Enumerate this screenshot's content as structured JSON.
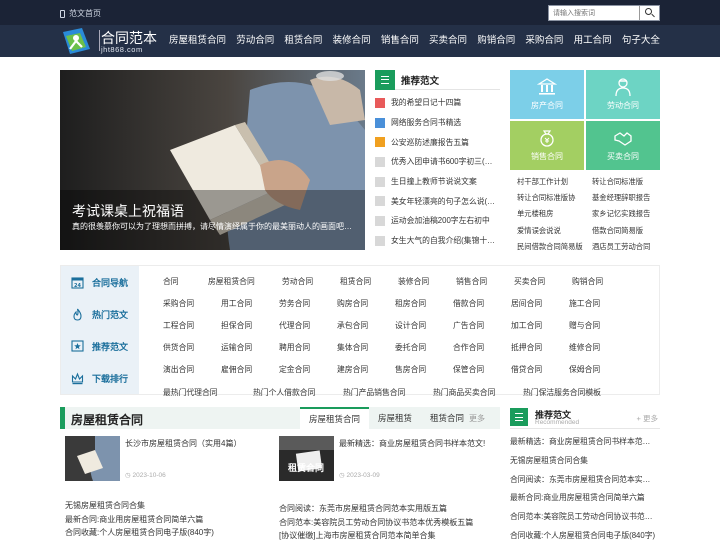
{
  "topbar": {
    "home_label": "范文首页",
    "search_placeholder": "请输入搜索词"
  },
  "logo": {
    "name": "合同范本",
    "domain": "jht868.com"
  },
  "nav": [
    "房屋租赁合同",
    "劳动合同",
    "租赁合同",
    "装修合同",
    "销售合同",
    "买卖合同",
    "购销合同",
    "采购合同",
    "用工合同",
    "句子大全"
  ],
  "hero": {
    "title": "考试课桌上祝福语",
    "subtitle": "真的很羡慕你可以为了理想而拼搏，请尽情演绎属于你的最美丽动人的画面吧…"
  },
  "recommend": {
    "title": "推荐范文",
    "items": [
      {
        "num": "1",
        "text": "我的希望日记十四篇",
        "color": "#e85a5a"
      },
      {
        "num": "2",
        "text": "网络服务合同书精选",
        "color": "#4a90d9"
      },
      {
        "num": "3",
        "text": "公安巡防述廉报告五篇",
        "color": "#f0a020"
      },
      {
        "num": "4",
        "text": "优秀入团申请书600字初三(…",
        "color": "#d8d8d8"
      },
      {
        "num": "5",
        "text": "生日撞上教师节说说文案",
        "color": "#d8d8d8"
      },
      {
        "num": "6",
        "text": "美女年轻漂亮的句子怎么说(…",
        "color": "#d8d8d8"
      },
      {
        "num": "7",
        "text": "运动会加油稿200字左右初中",
        "color": "#d8d8d8"
      },
      {
        "num": "8",
        "text": "女生大气的自我介绍(集锦十…",
        "color": "#d8d8d8"
      }
    ]
  },
  "tiles": [
    {
      "label": "房产合同",
      "color": "#7ccfe8",
      "icon": "bank-icon"
    },
    {
      "label": "劳动合同",
      "color": "#6dd4c4",
      "icon": "worker-icon"
    },
    {
      "label": "销售合同",
      "color": "#a3cf62",
      "icon": "money-bag-icon"
    },
    {
      "label": "买卖合同",
      "color": "#52c48f",
      "icon": "handshake-icon"
    }
  ],
  "quick_links": [
    [
      "村干部工作计划",
      "转让合同标准版"
    ],
    [
      "转让合同标准版协",
      "基金经理辞职报告"
    ],
    [
      "单元楼租房",
      "家乡记忆实践报告"
    ],
    [
      "爱情误会说说",
      "借款合同简易版"
    ],
    [
      "民间借款合同简易版",
      "酒店员工劳动合同"
    ]
  ],
  "category": {
    "side": [
      {
        "label": "合同导航",
        "icon": "date-icon"
      },
      {
        "label": "热门范文",
        "icon": "fire-icon"
      },
      {
        "label": "推荐范文",
        "icon": "star-badge-icon"
      },
      {
        "label": "下载排行",
        "icon": "crown-icon"
      }
    ],
    "rows": [
      [
        "合同",
        "房屋租赁合同",
        "劳动合同",
        "租赁合同",
        "装修合同",
        "销售合同",
        "买卖合同",
        "购销合同"
      ],
      [
        "采购合同",
        "用工合同",
        "劳务合同",
        "购房合同",
        "租房合同",
        "借款合同",
        "居间合同",
        "施工合同"
      ],
      [
        "工程合同",
        "担保合同",
        "代理合同",
        "承包合同",
        "设计合同",
        "广告合同",
        "加工合同",
        "赠与合同"
      ],
      [
        "供货合同",
        "运输合同",
        "聘用合同",
        "集体合同",
        "委托合同",
        "合作合同",
        "抵押合同",
        "维修合同"
      ],
      [
        "演出合同",
        "雇佣合同",
        "定金合同",
        "建房合同",
        "售房合同",
        "保管合同",
        "借贷合同",
        "保姆合同"
      ],
      [
        "最热门代理合同",
        "热门个人借款合同",
        "热门产品销售合同",
        "热门商品买卖合同",
        "热门保洁服务合同模板"
      ]
    ]
  },
  "section": {
    "title": "房屋租赁合同",
    "tabs": [
      "房屋租赁合同",
      "房屋租赁",
      "租赁合同"
    ],
    "more": "更多",
    "articles": [
      {
        "title": "长沙市房屋租赁合同（实用4篇）",
        "date": "2023-10-06",
        "img": "reading-man-icon"
      },
      {
        "title": "最新精选：商业房屋租赁合同书样本范文!",
        "date": "2023-03-09",
        "img": "contract-cover-icon",
        "img_text": "租赁合同"
      }
    ],
    "list_left": [
      "无锡房屋租赁合同合集",
      "最新合同:商业用房屋租赁合同简单六篇",
      "合同收藏:个人房屋租赁合同电子版(840字)"
    ],
    "list_right": [
      "合同阅读：东莞市房屋租赁合同范本实用版五篇",
      "合同范本:美容院员工劳动合同协议书范本优秀模板五篇",
      "[协议催缴]上海市房屋租赁合同范本简单合集"
    ]
  },
  "right_box": {
    "title": "推荐范文",
    "subtitle": "Recommended",
    "more": "+ 更多",
    "items": [
      "最新精选：商业房屋租赁合同书样本范…",
      "无锡房屋租赁合同合集",
      "合同阅读：东莞市房屋租赁合同范本实…",
      "最新合同:商业用房屋租赁合同简单六篇",
      "合同范本:美容院员工劳动合同协议书范…",
      "合同收藏:个人房屋租赁合同电子版(840字)"
    ]
  }
}
